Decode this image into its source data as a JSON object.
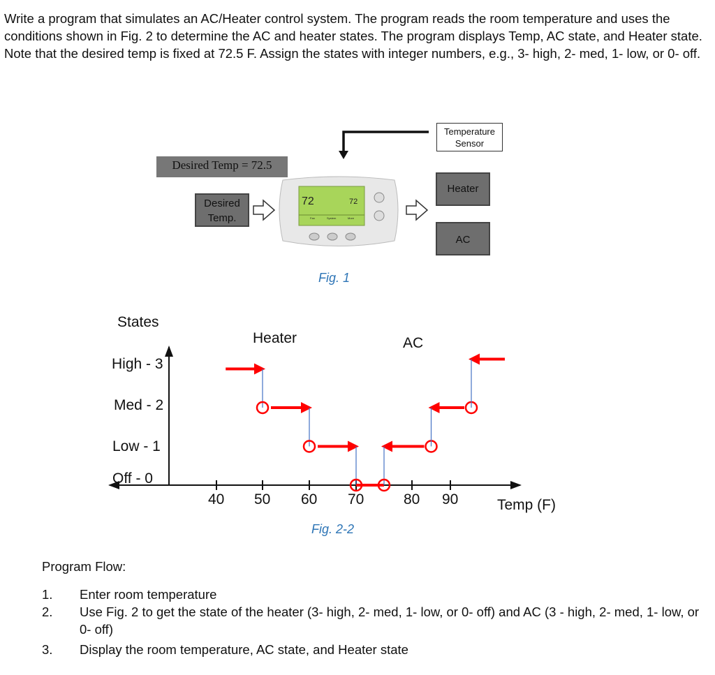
{
  "intro": "Write a program that simulates an AC/Heater control system. The program reads the room temperature and uses the conditions shown in Fig. 2 to determine the AC and heater states. The program displays Temp, AC state, and Heater state. Note that the desired temp is fixed at 72.5 F. Assign the states with integer numbers, e.g., 3- high, 2- med, 1- low, or 0- off.",
  "fig1": {
    "desired_eq": "Desired Temp = 72.5",
    "desired_box": [
      "Desired",
      "Temp."
    ],
    "sensor": [
      "Temperature",
      "Sensor"
    ],
    "heater": "Heater",
    "ac": "AC",
    "caption": "Fig. 1",
    "display": {
      "indoor": "72",
      "setting": "72",
      "buttons": [
        "Fan",
        "System",
        "More"
      ]
    }
  },
  "chart_data": {
    "type": "line",
    "title": "",
    "ylabel": "States",
    "xlabel": "Temp (F)",
    "y_ticks": [
      "Off - 0",
      "Low - 1",
      "Med - 2",
      "High - 3"
    ],
    "x_ticks": [
      40,
      50,
      60,
      70,
      80,
      90
    ],
    "annotations": [
      "Heater",
      "AC"
    ],
    "caption": "Fig. 2-2",
    "heater": [
      {
        "from": 42,
        "to": 50,
        "state": 3
      },
      {
        "from": 50,
        "to": 60,
        "state": 2
      },
      {
        "from": 60,
        "to": 70,
        "state": 1
      },
      {
        "from": 70,
        "to": 75,
        "state": 0
      }
    ],
    "ac": [
      {
        "from": 75,
        "to": 85,
        "state": 1
      },
      {
        "from": 85,
        "to": 95,
        "state": 2
      },
      {
        "from": 95,
        "to": 103,
        "state": 3
      }
    ],
    "colors": {
      "arrows": "#ff0000",
      "steps": "#4472c4"
    }
  },
  "flow": {
    "title": "Program Flow:",
    "items": [
      {
        "n": "1.",
        "text": "Enter room temperature"
      },
      {
        "n": "2.",
        "text": "Use Fig. 2 to get the state of the heater (3- high, 2- med, 1- low, or 0- off) and AC (3 - high, 2- med, 1- low, or 0- off)"
      },
      {
        "n": "3.",
        "text": "Display the room temperature, AC state, and Heater state"
      }
    ]
  }
}
